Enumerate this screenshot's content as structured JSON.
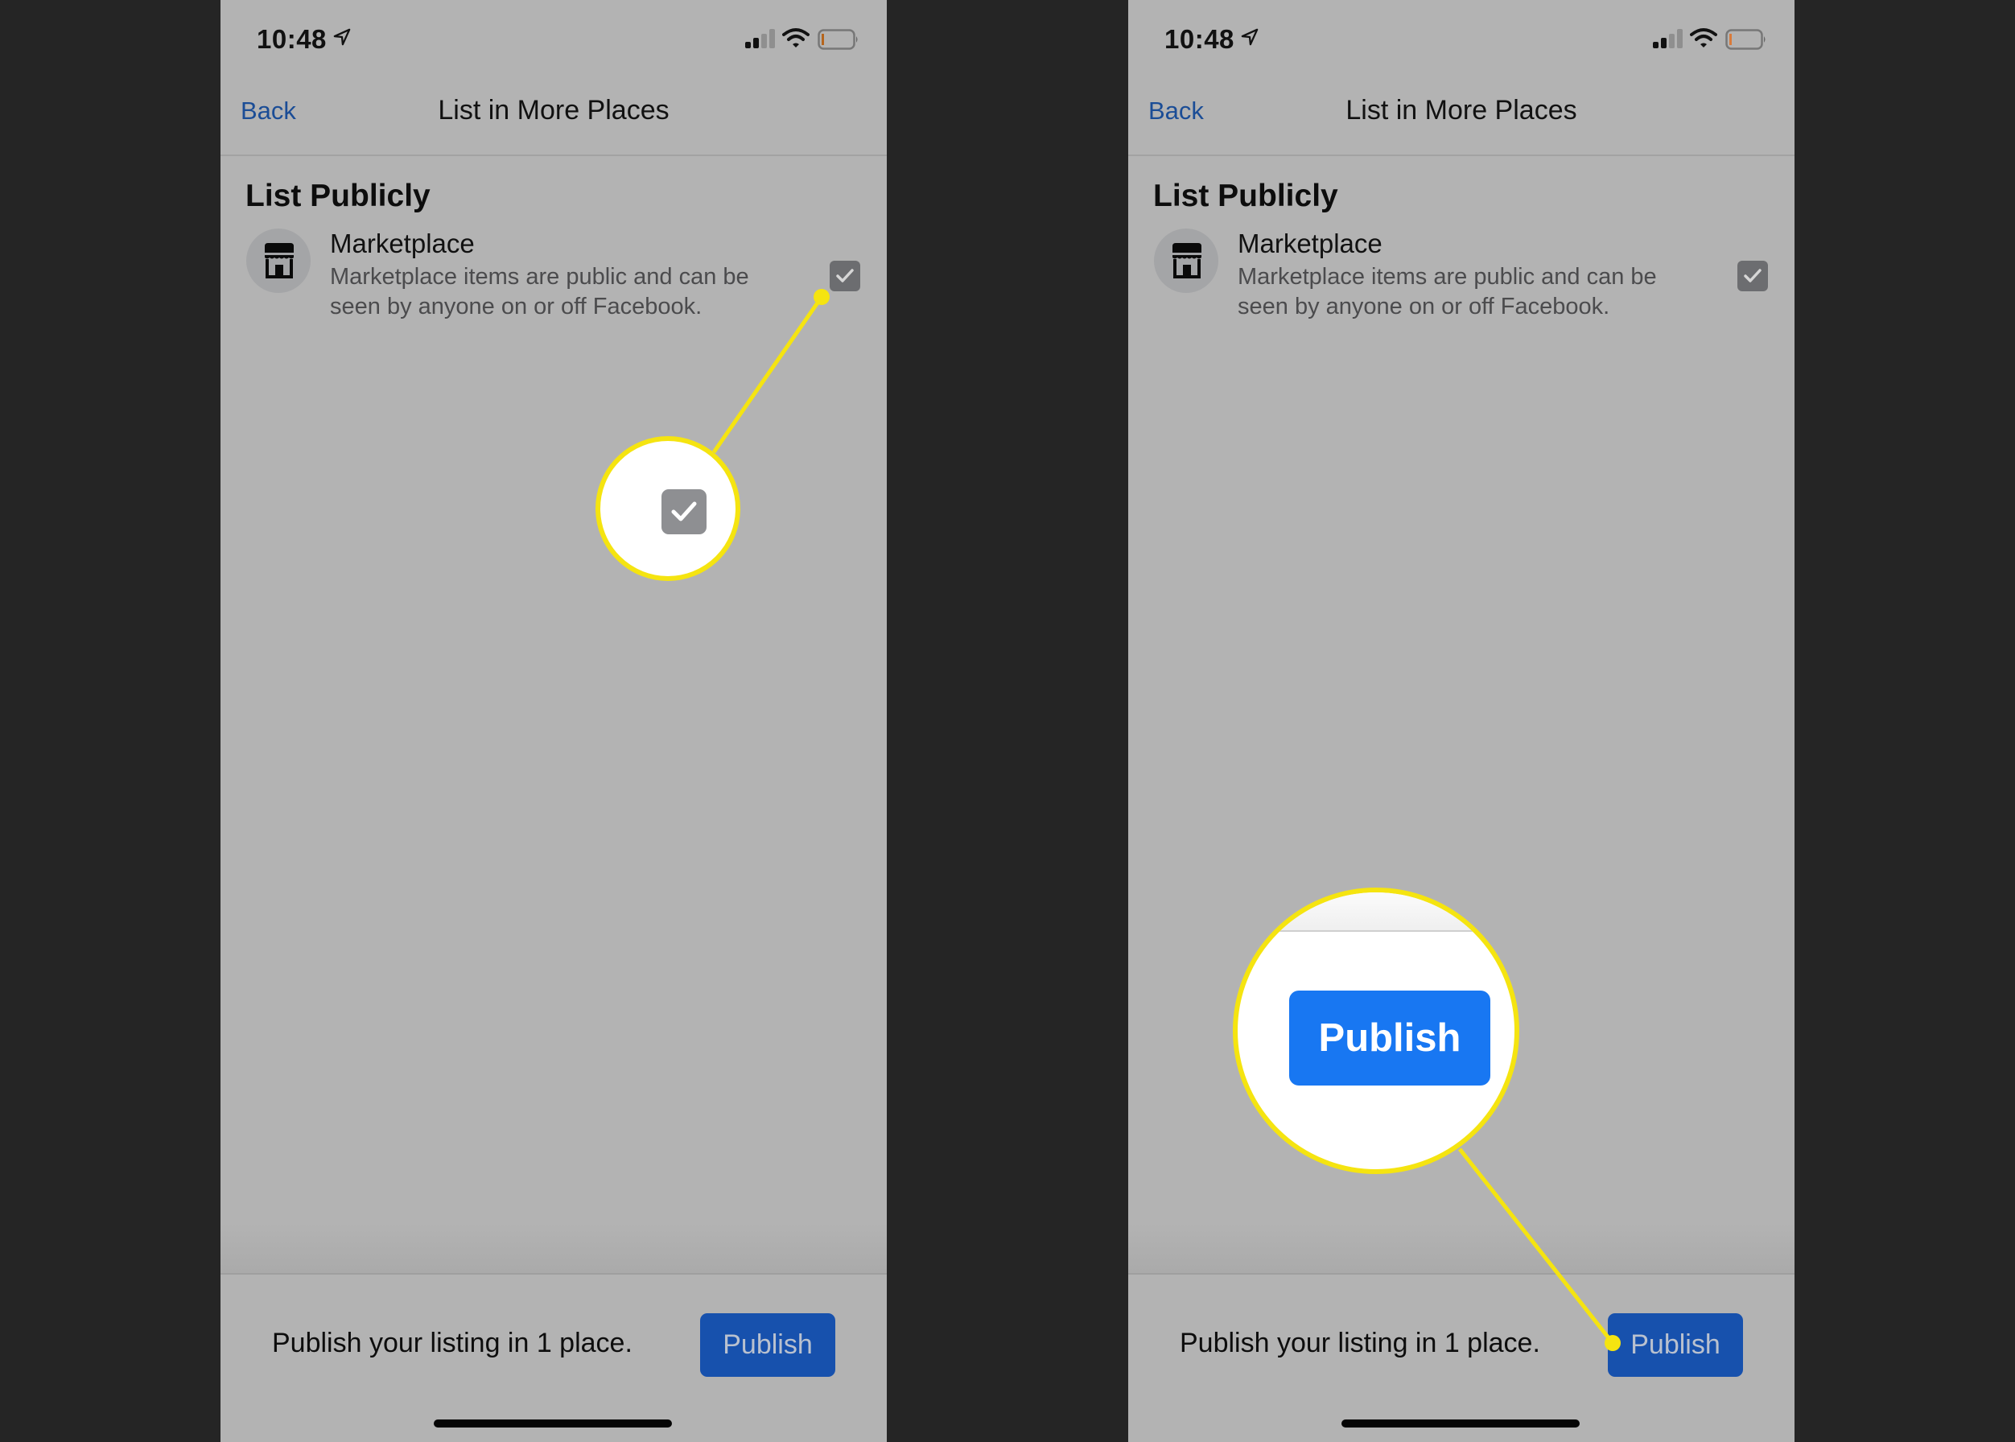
{
  "screens": [
    {
      "status": {
        "time": "10:48",
        "icons": [
          "location-arrow-icon",
          "signal-icon",
          "wifi-icon",
          "battery-icon"
        ]
      },
      "nav": {
        "back_label": "Back",
        "title": "List in More Places"
      },
      "section_title": "List Publicly",
      "option": {
        "icon": "storefront-icon",
        "title": "Marketplace",
        "description": "Marketplace items are public and can be seen by anyone on or off Facebook.",
        "checked": true
      },
      "footer": {
        "summary": "Publish your listing in 1 place.",
        "publish_label": "Publish"
      },
      "callout": {
        "target": "checkbox",
        "type": "magnified-checkbox"
      }
    },
    {
      "status": {
        "time": "10:48",
        "icons": [
          "location-arrow-icon",
          "signal-icon",
          "wifi-icon",
          "battery-icon"
        ]
      },
      "nav": {
        "back_label": "Back",
        "title": "List in More Places"
      },
      "section_title": "List Publicly",
      "option": {
        "icon": "storefront-icon",
        "title": "Marketplace",
        "description": "Marketplace items are public and can be seen by anyone on or off Facebook.",
        "checked": true
      },
      "footer": {
        "summary": "Publish your listing in 1 place.",
        "publish_label": "Publish"
      },
      "callout": {
        "target": "publish-button",
        "type": "magnified-button",
        "label": "Publish"
      }
    }
  ],
  "colors": {
    "background": "#252525",
    "screen_dimmed": "#b3b3b3",
    "link": "#1b4d96",
    "publish_button": "#1751ad",
    "publish_button_highlight": "#1877f2",
    "callout": "#f5e410"
  }
}
